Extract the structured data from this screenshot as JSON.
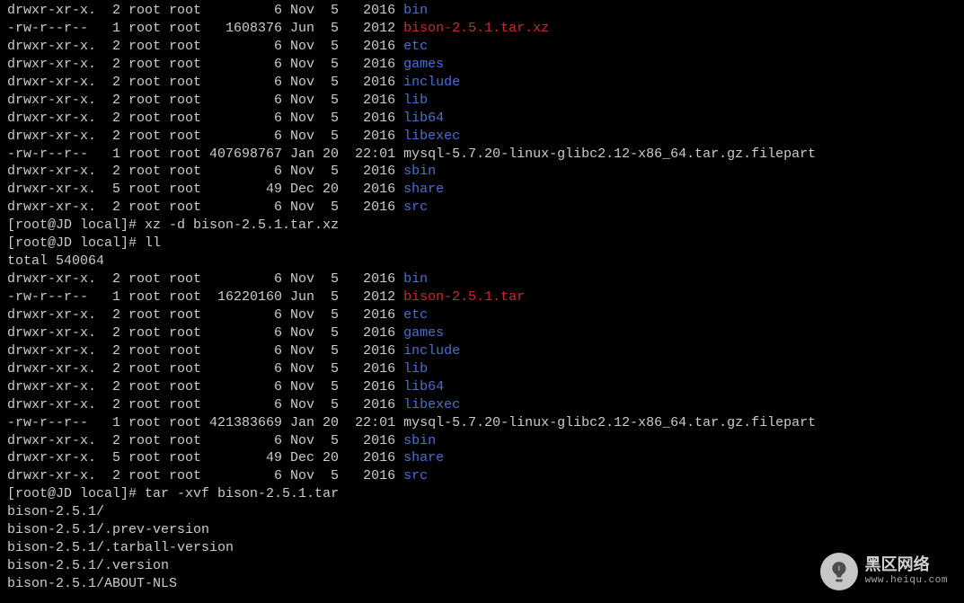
{
  "listing1": [
    {
      "perm": "drwxr-xr-x.",
      "links": "2",
      "owner": "root",
      "group": "root",
      "size": "6",
      "month": "Nov",
      "day": "5",
      "time": "2016",
      "name": "bin",
      "cls": "blue"
    },
    {
      "perm": "-rw-r--r--",
      "links": "1",
      "owner": "root",
      "group": "root",
      "size": "1608376",
      "month": "Jun",
      "day": "5",
      "time": "2012",
      "name": "bison-2.5.1.tar.xz",
      "cls": "red"
    },
    {
      "perm": "drwxr-xr-x.",
      "links": "2",
      "owner": "root",
      "group": "root",
      "size": "6",
      "month": "Nov",
      "day": "5",
      "time": "2016",
      "name": "etc",
      "cls": "blue"
    },
    {
      "perm": "drwxr-xr-x.",
      "links": "2",
      "owner": "root",
      "group": "root",
      "size": "6",
      "month": "Nov",
      "day": "5",
      "time": "2016",
      "name": "games",
      "cls": "blue"
    },
    {
      "perm": "drwxr-xr-x.",
      "links": "2",
      "owner": "root",
      "group": "root",
      "size": "6",
      "month": "Nov",
      "day": "5",
      "time": "2016",
      "name": "include",
      "cls": "blue"
    },
    {
      "perm": "drwxr-xr-x.",
      "links": "2",
      "owner": "root",
      "group": "root",
      "size": "6",
      "month": "Nov",
      "day": "5",
      "time": "2016",
      "name": "lib",
      "cls": "blue"
    },
    {
      "perm": "drwxr-xr-x.",
      "links": "2",
      "owner": "root",
      "group": "root",
      "size": "6",
      "month": "Nov",
      "day": "5",
      "time": "2016",
      "name": "lib64",
      "cls": "blue"
    },
    {
      "perm": "drwxr-xr-x.",
      "links": "2",
      "owner": "root",
      "group": "root",
      "size": "6",
      "month": "Nov",
      "day": "5",
      "time": "2016",
      "name": "libexec",
      "cls": "blue"
    },
    {
      "perm": "-rw-r--r--",
      "links": "1",
      "owner": "root",
      "group": "root",
      "size": "407698767",
      "month": "Jan",
      "day": "20",
      "time": "22:01",
      "name": "mysql-5.7.20-linux-glibc2.12-x86_64.tar.gz.filepart",
      "cls": ""
    },
    {
      "perm": "drwxr-xr-x.",
      "links": "2",
      "owner": "root",
      "group": "root",
      "size": "6",
      "month": "Nov",
      "day": "5",
      "time": "2016",
      "name": "sbin",
      "cls": "blue"
    },
    {
      "perm": "drwxr-xr-x.",
      "links": "5",
      "owner": "root",
      "group": "root",
      "size": "49",
      "month": "Dec",
      "day": "20",
      "time": "2016",
      "name": "share",
      "cls": "blue"
    },
    {
      "perm": "drwxr-xr-x.",
      "links": "2",
      "owner": "root",
      "group": "root",
      "size": "6",
      "month": "Nov",
      "day": "5",
      "time": "2016",
      "name": "src",
      "cls": "blue"
    }
  ],
  "prompt1": {
    "prefix": "[root@JD local]# ",
    "cmd": "xz -d bison-2.5.1.tar.xz"
  },
  "prompt2": {
    "prefix": "[root@JD local]# ",
    "cmd": "ll"
  },
  "total": "total 540064",
  "listing2": [
    {
      "perm": "drwxr-xr-x.",
      "links": "2",
      "owner": "root",
      "group": "root",
      "size": "6",
      "month": "Nov",
      "day": "5",
      "time": "2016",
      "name": "bin",
      "cls": "blue"
    },
    {
      "perm": "-rw-r--r--",
      "links": "1",
      "owner": "root",
      "group": "root",
      "size": "16220160",
      "month": "Jun",
      "day": "5",
      "time": "2012",
      "name": "bison-2.5.1.tar",
      "cls": "red"
    },
    {
      "perm": "drwxr-xr-x.",
      "links": "2",
      "owner": "root",
      "group": "root",
      "size": "6",
      "month": "Nov",
      "day": "5",
      "time": "2016",
      "name": "etc",
      "cls": "blue"
    },
    {
      "perm": "drwxr-xr-x.",
      "links": "2",
      "owner": "root",
      "group": "root",
      "size": "6",
      "month": "Nov",
      "day": "5",
      "time": "2016",
      "name": "games",
      "cls": "blue"
    },
    {
      "perm": "drwxr-xr-x.",
      "links": "2",
      "owner": "root",
      "group": "root",
      "size": "6",
      "month": "Nov",
      "day": "5",
      "time": "2016",
      "name": "include",
      "cls": "blue"
    },
    {
      "perm": "drwxr-xr-x.",
      "links": "2",
      "owner": "root",
      "group": "root",
      "size": "6",
      "month": "Nov",
      "day": "5",
      "time": "2016",
      "name": "lib",
      "cls": "blue"
    },
    {
      "perm": "drwxr-xr-x.",
      "links": "2",
      "owner": "root",
      "group": "root",
      "size": "6",
      "month": "Nov",
      "day": "5",
      "time": "2016",
      "name": "lib64",
      "cls": "blue"
    },
    {
      "perm": "drwxr-xr-x.",
      "links": "2",
      "owner": "root",
      "group": "root",
      "size": "6",
      "month": "Nov",
      "day": "5",
      "time": "2016",
      "name": "libexec",
      "cls": "blue"
    },
    {
      "perm": "-rw-r--r--",
      "links": "1",
      "owner": "root",
      "group": "root",
      "size": "421383669",
      "month": "Jan",
      "day": "20",
      "time": "22:01",
      "name": "mysql-5.7.20-linux-glibc2.12-x86_64.tar.gz.filepart",
      "cls": ""
    },
    {
      "perm": "drwxr-xr-x.",
      "links": "2",
      "owner": "root",
      "group": "root",
      "size": "6",
      "month": "Nov",
      "day": "5",
      "time": "2016",
      "name": "sbin",
      "cls": "blue"
    },
    {
      "perm": "drwxr-xr-x.",
      "links": "5",
      "owner": "root",
      "group": "root",
      "size": "49",
      "month": "Dec",
      "day": "20",
      "time": "2016",
      "name": "share",
      "cls": "blue"
    },
    {
      "perm": "drwxr-xr-x.",
      "links": "2",
      "owner": "root",
      "group": "root",
      "size": "6",
      "month": "Nov",
      "day": "5",
      "time": "2016",
      "name": "src",
      "cls": "blue"
    }
  ],
  "prompt3": {
    "prefix": "[root@JD local]# ",
    "cmd": "tar -xvf bison-2.5.1.tar"
  },
  "tar_output": [
    "bison-2.5.1/",
    "bison-2.5.1/.prev-version",
    "bison-2.5.1/.tarball-version",
    "bison-2.5.1/.version",
    "bison-2.5.1/ABOUT-NLS"
  ],
  "watermark": {
    "title": "黑区网络",
    "url": "www.heiqu.com"
  }
}
